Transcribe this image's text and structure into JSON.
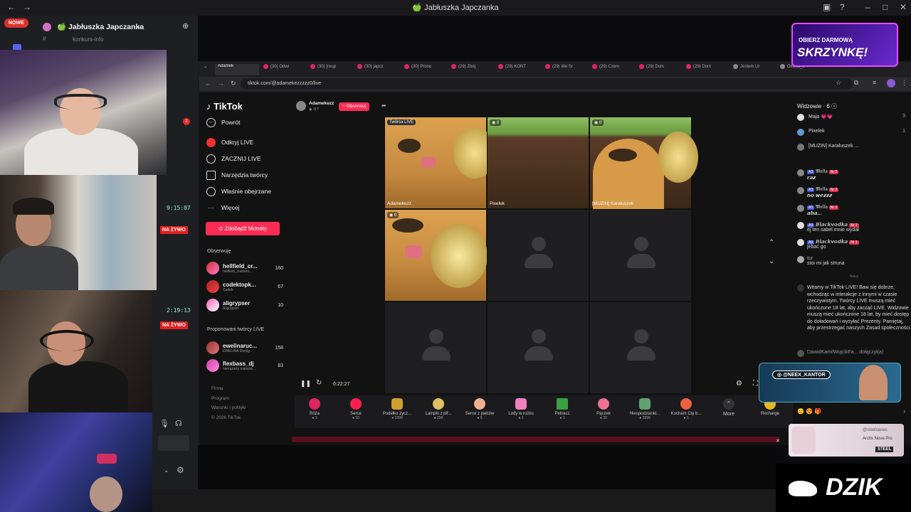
{
  "window": {
    "title": "🍏 Jabłuszka Japczanka"
  },
  "discord": {
    "new_badge": "NOWE",
    "server_title": "🍏 Jabłuszka Japczanka",
    "channel": "konkurs-info",
    "mention_count": "1",
    "times": [
      "9:15:07",
      "2:19:13"
    ],
    "live_label": "NA ŻYWO"
  },
  "tabs": [
    "Adamek",
    "(30) Odwi",
    "(30) [reup",
    "(30) japcz",
    "(30) Prono",
    "(29) Zbój",
    "(29) KONT",
    "(29) We Sr",
    "(29) Czem",
    "(29) Dom",
    "(29) Dom",
    "Jestem Ur",
    "Oliwka_tf"
  ],
  "address": {
    "url": "tiktok.com/@adamekezzzzz0/live"
  },
  "tiktok": {
    "logo": "TikTok",
    "back": "Powrót",
    "nav": [
      "Odkryj LIVE",
      "ZACZNIJ LIVE",
      "Narzędzia twórcy",
      "Właśnie obejrzane",
      "Więcej"
    ],
    "coins_button": "Zdobądź Monety",
    "following_header": "Obserwuję",
    "following": [
      {
        "name": "hellfield_cr...",
        "sub": "hellfield_crackho...",
        "count": "160"
      },
      {
        "name": "codektopk...",
        "sub": "Codek",
        "count": "67"
      },
      {
        "name": "aligrypser",
        "sub": "Aligrypser",
        "count": "10"
      }
    ],
    "suggested_header": "Proponowani twórcy LIVE",
    "suggested": [
      {
        "name": "ewelinaruc...",
        "sub": "EWELINA Ruckg...",
        "count": "158"
      },
      {
        "name": "flexbass_dj",
        "sub": "nienażarty markow...",
        "count": "83"
      }
    ],
    "footer": [
      "Firma",
      "Program",
      "Warunki i polityki",
      "© 2026 TikTok"
    ],
    "streamer": {
      "name": "Adamekezz",
      "viewers": "117",
      "follow_button": "+ Obserwuj"
    },
    "grid_labels": {
      "creator_tag": "Twórca LIVE",
      "c0": "Adamekezz",
      "c1": "Pixelek",
      "c2": "[MUZIN] Karaluszek",
      "zero": "0"
    },
    "timer": "0:22:27",
    "gifts": [
      {
        "name": "Róża",
        "price": "1",
        "color": "#e0245e"
      },
      {
        "name": "Serce",
        "price": "10",
        "color": "#ff2050"
      },
      {
        "name": "Pudełko życz...",
        "price": "1999",
        "color": "#d0a030"
      },
      {
        "name": "Lampki z płf...",
        "price": "299",
        "color": "#e0c060"
      },
      {
        "name": "Serce z palców",
        "price": "5",
        "color": "#f0b090"
      },
      {
        "name": "Lody w rożku",
        "price": "1",
        "color": "#f080c0"
      },
      {
        "name": "Pełzacz",
        "price": "1",
        "color": "#3aa040"
      },
      {
        "name": "Pączek",
        "price": "30",
        "color": "#f07090"
      },
      {
        "name": "Niespodzianki...",
        "price": "2999",
        "color": "#60a070"
      },
      {
        "name": "Kocham Cię b...",
        "price": "1",
        "color": "#f06040"
      }
    ],
    "more": "More",
    "recharge": "Recharge",
    "viewers_header": "Widzowie · 6",
    "top_viewers": [
      {
        "name": "Maja 💗💗",
        "rank": "3"
      },
      {
        "name": "Pixelek",
        "rank": "1"
      },
      {
        "name": "[MUZIN] Karaluszek ...",
        "rank": ""
      }
    ],
    "chat": [
      {
        "user": "𝕸𝖊𝖑𝖑𝖆",
        "lvl": "A3",
        "fan": "Nr 2",
        "msg": "𝙧𝙖𝙯"
      },
      {
        "user": "𝕸𝖊𝖑𝖑𝖆",
        "lvl": "A3",
        "fan": "Nr 2",
        "msg": "𝙣𝙤 𝙬𝙚𝙯𝙯𝙯"
      },
      {
        "user": "𝕸𝖊𝖑𝖑𝖆",
        "lvl": "A3",
        "fan": "Nr 2",
        "msg": "𝙖𝙝𝙖..."
      },
      {
        "user": "𝘽𝙡𝙖𝙘𝙠𝙫𝙤𝙙𝙠𝙖",
        "lvl": "A9",
        "fan": "Nr 1",
        "msg": "ej ten sabel mnie wydał"
      },
      {
        "user": "𝘽𝙡𝙖𝙘𝙠𝙫𝙤𝙙𝙠𝙖",
        "lvl": "A9",
        "fan": "Nr 1",
        "msg": "jebać go"
      },
      {
        "user": "tur",
        "lvl": "",
        "fan": "",
        "msg": "stoi mi jak struna"
      }
    ],
    "divider": "Nowy",
    "welcome": "Witamy w TikTok LIVE! Baw się dobrze, wchodząc w interakcje z innymi w czasie rzeczywistym. Twórcy LIVE muszą mieć ukończone 18 lat, aby zacząć LIVE. Widzowie muszą mieć ukończone 18 lat, by mieć dostęp do doładowań i wysyłać Prezenty. Pamiętaj, aby przestrzegać naszych Zasad społeczności.",
    "joined_user": "DawidKamilWujcikFa...",
    "joined_text": "dołączył(a)"
  },
  "overlays": {
    "promo_top": "OBIERZ DARMOWĄ",
    "promo_main": "SKRZYNKĘ!",
    "neex": "@NEEX_KANTOR",
    "steel_handle": "@steelseries",
    "steel_product": "Arctis Nova Pro",
    "steel_brand": "STEEL",
    "dzik": "DZIK"
  }
}
